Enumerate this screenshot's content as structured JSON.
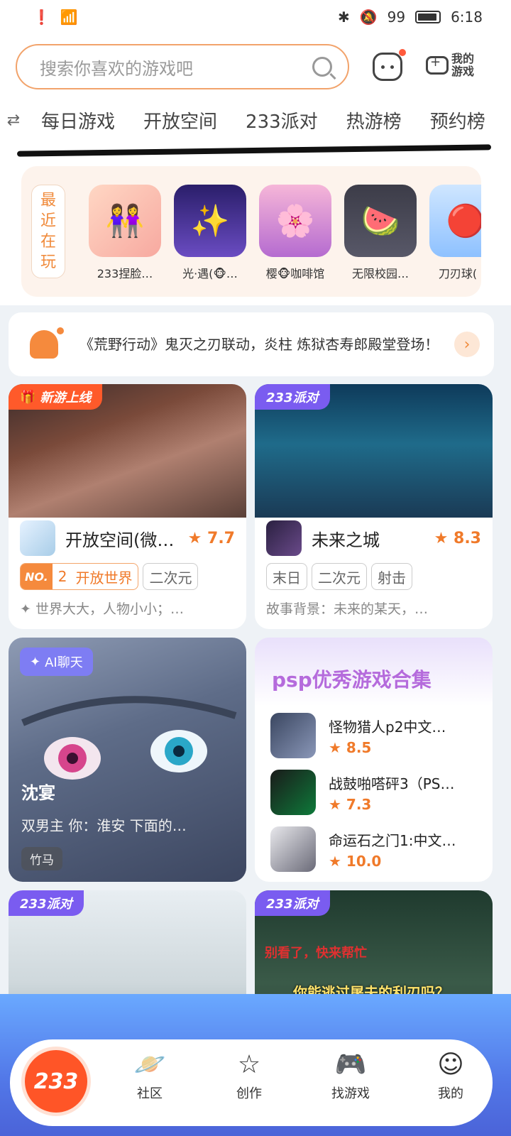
{
  "status_bar": {
    "battery": "99",
    "time": "6:18"
  },
  "header": {
    "search_placeholder": "搜索你喜欢的游戏吧",
    "my_games_label": "我的游戏"
  },
  "tabs": [
    "每日游戏",
    "开放空间",
    "233派对",
    "热游榜",
    "预约榜"
  ],
  "recent": {
    "label": "最近在玩",
    "games": [
      {
        "name": "233捏脸…",
        "icon": "👭"
      },
      {
        "name": "光·遇(🐵…",
        "icon": "✨"
      },
      {
        "name": "樱🐵咖啡馆",
        "icon": "🌸"
      },
      {
        "name": "无限校园…",
        "icon": "🍉"
      },
      {
        "name": "刀刃球(",
        "icon": "🔴"
      }
    ]
  },
  "notice": {
    "text": "《荒野行动》鬼灭之刃联动，炎柱 炼狱杏寿郎殿堂登场！"
  },
  "cards": {
    "open_world": {
      "badge": "新游上线",
      "title": "开放空间(微…",
      "rating": "7.7",
      "rank_no": "2",
      "rank_label": "开放世界",
      "chip2": "二次元",
      "desc": "世界大大，人物小小；…"
    },
    "future_city": {
      "badge": "233派对",
      "title": "未来之城",
      "rating": "8.3",
      "chips": [
        "末日",
        "二次元",
        "射击"
      ],
      "desc": "故事背景：未来的某天，…"
    }
  },
  "ai_chat": {
    "badge": "AI聊天",
    "name": "沈宴",
    "desc": "双男主 你：淮安 下面的…",
    "tag": "竹马"
  },
  "collection": {
    "title": "psp优秀游戏合集",
    "items": [
      {
        "name": "怪物猎人p2中文…",
        "rating": "8.5"
      },
      {
        "name": "战鼓啪嗒砰3（PS…",
        "rating": "7.3"
      },
      {
        "name": "命运石之门1:中文…",
        "rating": "10.0"
      }
    ]
  },
  "bottom_cards": {
    "left_badge": "233派对",
    "right_badge": "233派对",
    "right_red_text": "别看了，快来帮忙",
    "right_yellow_text": "你能逃过屠夫的利刃吗？"
  },
  "nav": {
    "home": "233",
    "items": [
      "社区",
      "创作",
      "找游戏",
      "我的"
    ]
  },
  "colors": {
    "accent": "#f58a3d",
    "party": "#7a5cf0",
    "home": "#ff5527"
  }
}
